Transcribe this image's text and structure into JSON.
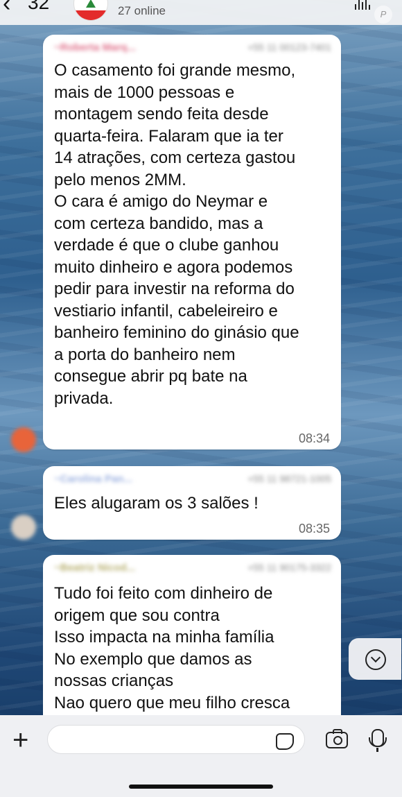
{
  "header": {
    "back_count": "32",
    "subtitle": "27 online",
    "watermark": "P"
  },
  "messages": [
    {
      "sender": "~Roberta Marq...",
      "phone": "+55 11 00123-7401",
      "text": "O casamento foi grande mesmo,\nmais de 1000 pessoas e\nmontagem sendo feita desde\nquarta-feira. Falaram que ia ter\n14 atrações, com certeza gastou\npelo menos 2MM.\nO cara é amigo do Neymar e\ncom certeza bandido, mas a\nverdade é que o clube ganhou\nmuito dinheiro e agora podemos\npedir para investir na reforma do\nvestiario infantil, cabeleireiro e\nbanheiro feminino do ginásio que\na porta do banheiro nem\nconsegue abrir pq bate na\nprivada.",
      "time": "08:34",
      "avatar_color": "#e8643a"
    },
    {
      "sender": "~Carolina Pan...",
      "phone": "+55 11 98721-1005",
      "text": "Eles alugaram os 3 salões !",
      "time": "08:35",
      "avatar_color": "#d9cfc4"
    },
    {
      "sender": "~Beatriz Nicod...",
      "phone": "+55 11 90175-3322",
      "text": "Tudo foi feito com dinheiro de\norigem que sou contra\nIsso impacta na minha família\nNo exemplo que damos as\nnossas crianças\nNao quero que meu filho cresca",
      "time": ""
    }
  ],
  "composer": {
    "placeholder": ""
  },
  "icons": {
    "back": "chevron-left-icon",
    "scroll": "chevron-down-circle-icon",
    "plus": "plus-icon",
    "sticker": "sticker-icon",
    "camera": "camera-icon",
    "mic": "microphone-icon"
  }
}
